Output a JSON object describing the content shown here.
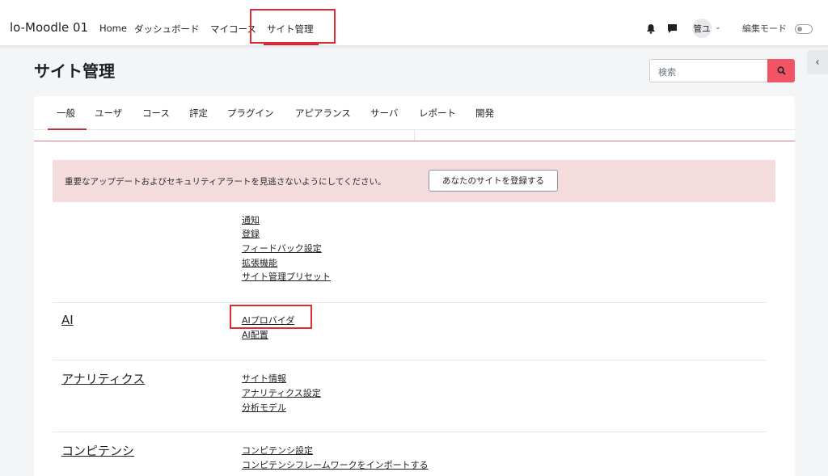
{
  "navbar": {
    "brand": "lo-Moodle 01",
    "links": [
      "Home",
      "ダッシュボード",
      "マイコース",
      "サイト管理"
    ],
    "avatar": "管ユ",
    "edit_mode_label": "編集モード"
  },
  "page": {
    "title": "サイト管理",
    "search_placeholder": "検索"
  },
  "tabs": [
    "一般",
    "ユーザ",
    "コース",
    "評定",
    "プラグイン",
    "アピアランス",
    "サーバ",
    "レポート",
    "開発"
  ],
  "alert": {
    "text": "重要なアップデートおよびセキュリティアラートを見逃さないようにしてください。",
    "button": "あなたのサイトを登録する"
  },
  "sections": {
    "general_links": [
      "通知",
      "登録",
      "フィードバック設定",
      "拡張機能",
      "サイト管理プリセット"
    ],
    "ai": {
      "title": "AI",
      "links": [
        "AIプロバイダ",
        "AI配置"
      ]
    },
    "analytics": {
      "title": "アナリティクス",
      "links": [
        "サイト情報",
        "アナリティクス設定",
        "分析モデル"
      ]
    },
    "competencies": {
      "title": "コンピテンシ",
      "links": [
        "コンピテンシ設定",
        "コンピテンシフレームワークをインポートする"
      ]
    }
  },
  "colors": {
    "accent": "#c22d3b",
    "highlight": "#e02a35",
    "alert_bg": "#f4dcdd",
    "search_button": "#f25466"
  }
}
